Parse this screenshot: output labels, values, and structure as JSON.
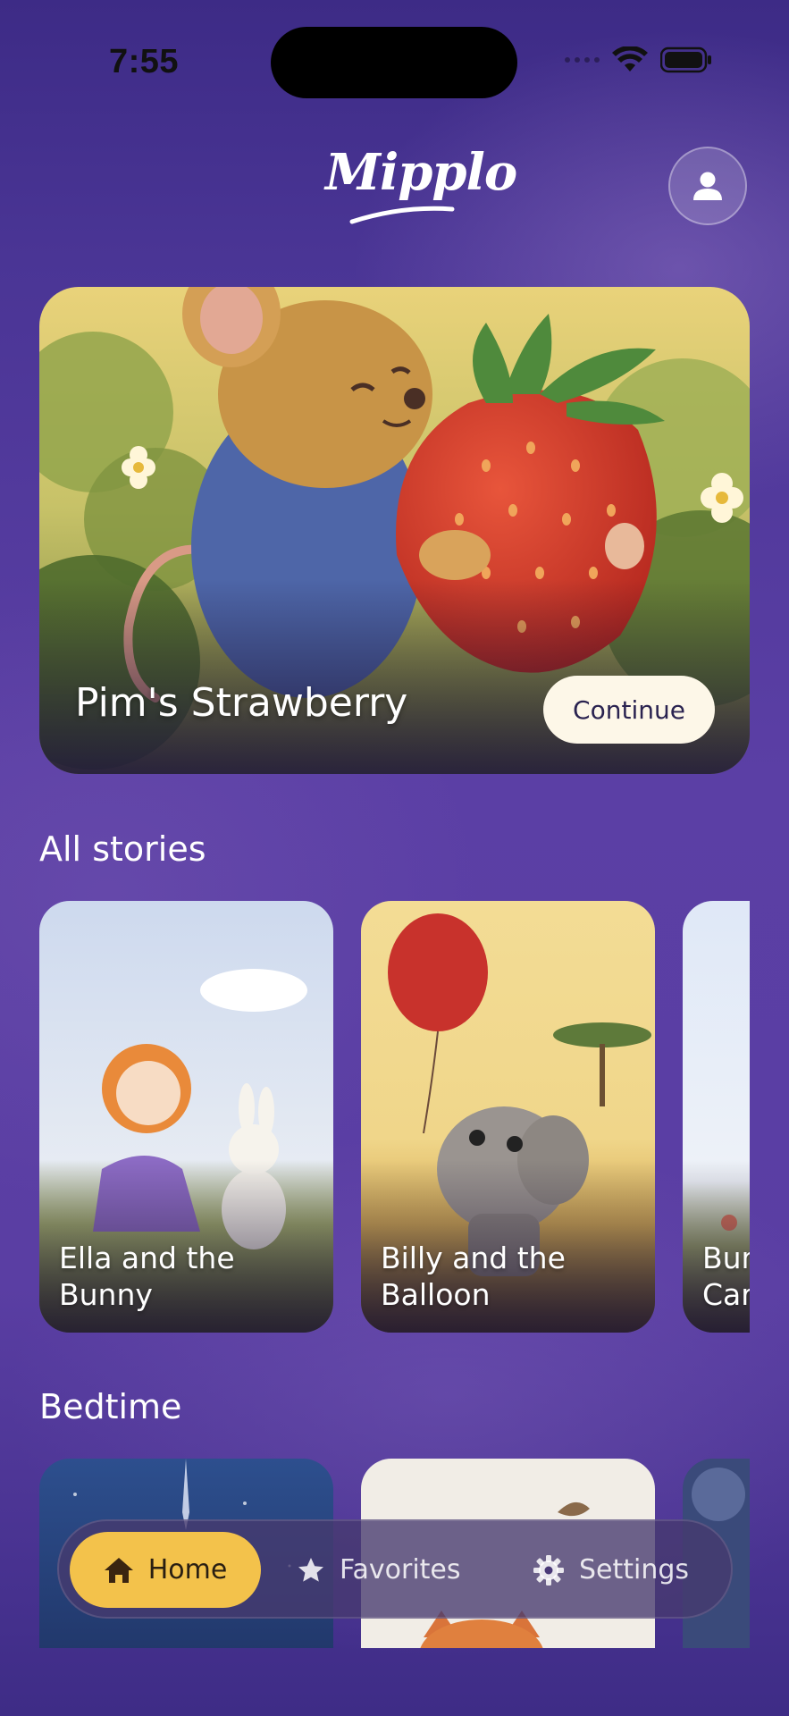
{
  "status_bar": {
    "time": "7:55"
  },
  "header": {
    "logo_text": "Mipplo",
    "profile_icon": "person-icon"
  },
  "hero": {
    "title": "Pim's Strawberry",
    "continue_label": "Continue"
  },
  "sections": {
    "all_stories": {
      "title": "All stories",
      "cards": [
        {
          "title": "Ella and the\nBunny"
        },
        {
          "title": "Billy and the\nBalloon"
        },
        {
          "title": "Bun\nCar"
        }
      ]
    },
    "bedtime": {
      "title": "Bedtime"
    }
  },
  "bottom_nav": {
    "items": [
      {
        "label": "Home",
        "icon": "home-icon",
        "active": true
      },
      {
        "label": "Favorites",
        "icon": "star-icon",
        "active": false
      },
      {
        "label": "Settings",
        "icon": "gear-icon",
        "active": false
      }
    ],
    "active_color": "#f3c24b"
  }
}
